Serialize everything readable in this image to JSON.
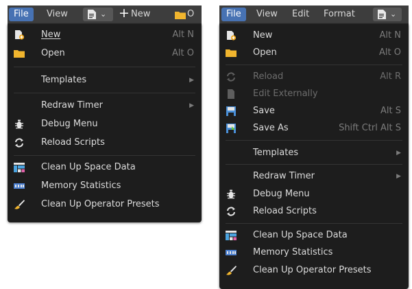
{
  "left": {
    "topbar": {
      "file": "File",
      "view": "View",
      "new": "New",
      "folder_hint": "O"
    },
    "menu": {
      "new": {
        "label": "New",
        "shortcut": "Alt N",
        "icon": "new-file-icon"
      },
      "open": {
        "label": "Open",
        "shortcut": "Alt O",
        "icon": "folder-icon"
      },
      "templates": {
        "label": "Templates"
      },
      "redraw_timer": {
        "label": "Redraw Timer"
      },
      "debug_menu": {
        "label": "Debug Menu",
        "icon": "bug-icon"
      },
      "reload_scripts": {
        "label": "Reload Scripts",
        "icon": "reload-icon"
      },
      "cleanup_space": {
        "label": "Clean Up Space Data",
        "icon": "space-data-icon"
      },
      "memory_stats": {
        "label": "Memory Statistics",
        "icon": "memory-icon"
      },
      "cleanup_presets": {
        "label": "Clean Up Operator Presets",
        "icon": "brush-icon"
      }
    }
  },
  "right": {
    "topbar": {
      "file": "File",
      "view": "View",
      "edit": "Edit",
      "format": "Format"
    },
    "menu": {
      "new": {
        "label": "New",
        "shortcut": "Alt N"
      },
      "open": {
        "label": "Open",
        "shortcut": "Alt O"
      },
      "reload": {
        "label": "Reload",
        "shortcut": "Alt R"
      },
      "edit_externally": {
        "label": "Edit Externally"
      },
      "save": {
        "label": "Save",
        "shortcut": "Alt S"
      },
      "save_as": {
        "label": "Save As",
        "shortcut": "Shift Ctrl Alt S"
      },
      "templates": {
        "label": "Templates"
      },
      "redraw_timer": {
        "label": "Redraw Timer"
      },
      "debug_menu": {
        "label": "Debug Menu"
      },
      "reload_scripts": {
        "label": "Reload Scripts"
      },
      "cleanup_space": {
        "label": "Clean Up Space Data"
      },
      "memory_stats": {
        "label": "Memory Statistics"
      },
      "cleanup_presets": {
        "label": "Clean Up Operator Presets"
      }
    }
  },
  "colors": {
    "menu_bg": "#1d1d1d",
    "topbar_bg": "#3d3d3d",
    "active_tab": "#4772b3",
    "text": "#dcdcdc",
    "shortcut_text": "#7c7c7c",
    "disabled_text": "#6d6d6d"
  }
}
